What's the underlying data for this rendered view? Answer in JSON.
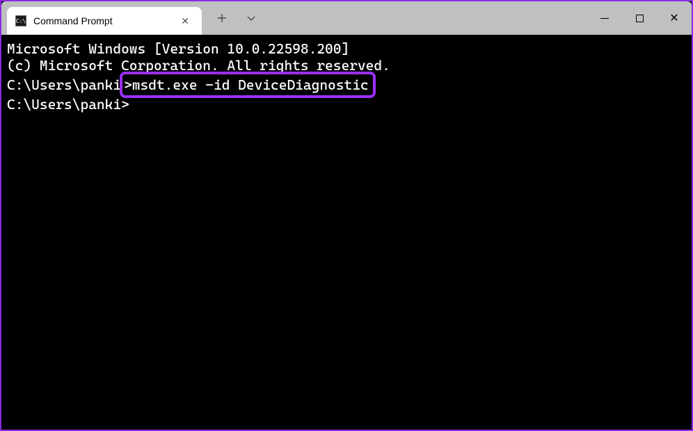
{
  "window": {
    "tab_title": "Command Prompt",
    "tab_icon_label": "C:\\"
  },
  "terminal": {
    "line1": "Microsoft Windows [Version 10.0.22598.200]",
    "line2": "(c) Microsoft Corporation. All rights reserved.",
    "blank": "",
    "prompt1_prefix": "C:\\Users\\panki",
    "prompt1_command": ">msdt.exe -id DeviceDiagnostic",
    "prompt2": "C:\\Users\\panki>"
  }
}
